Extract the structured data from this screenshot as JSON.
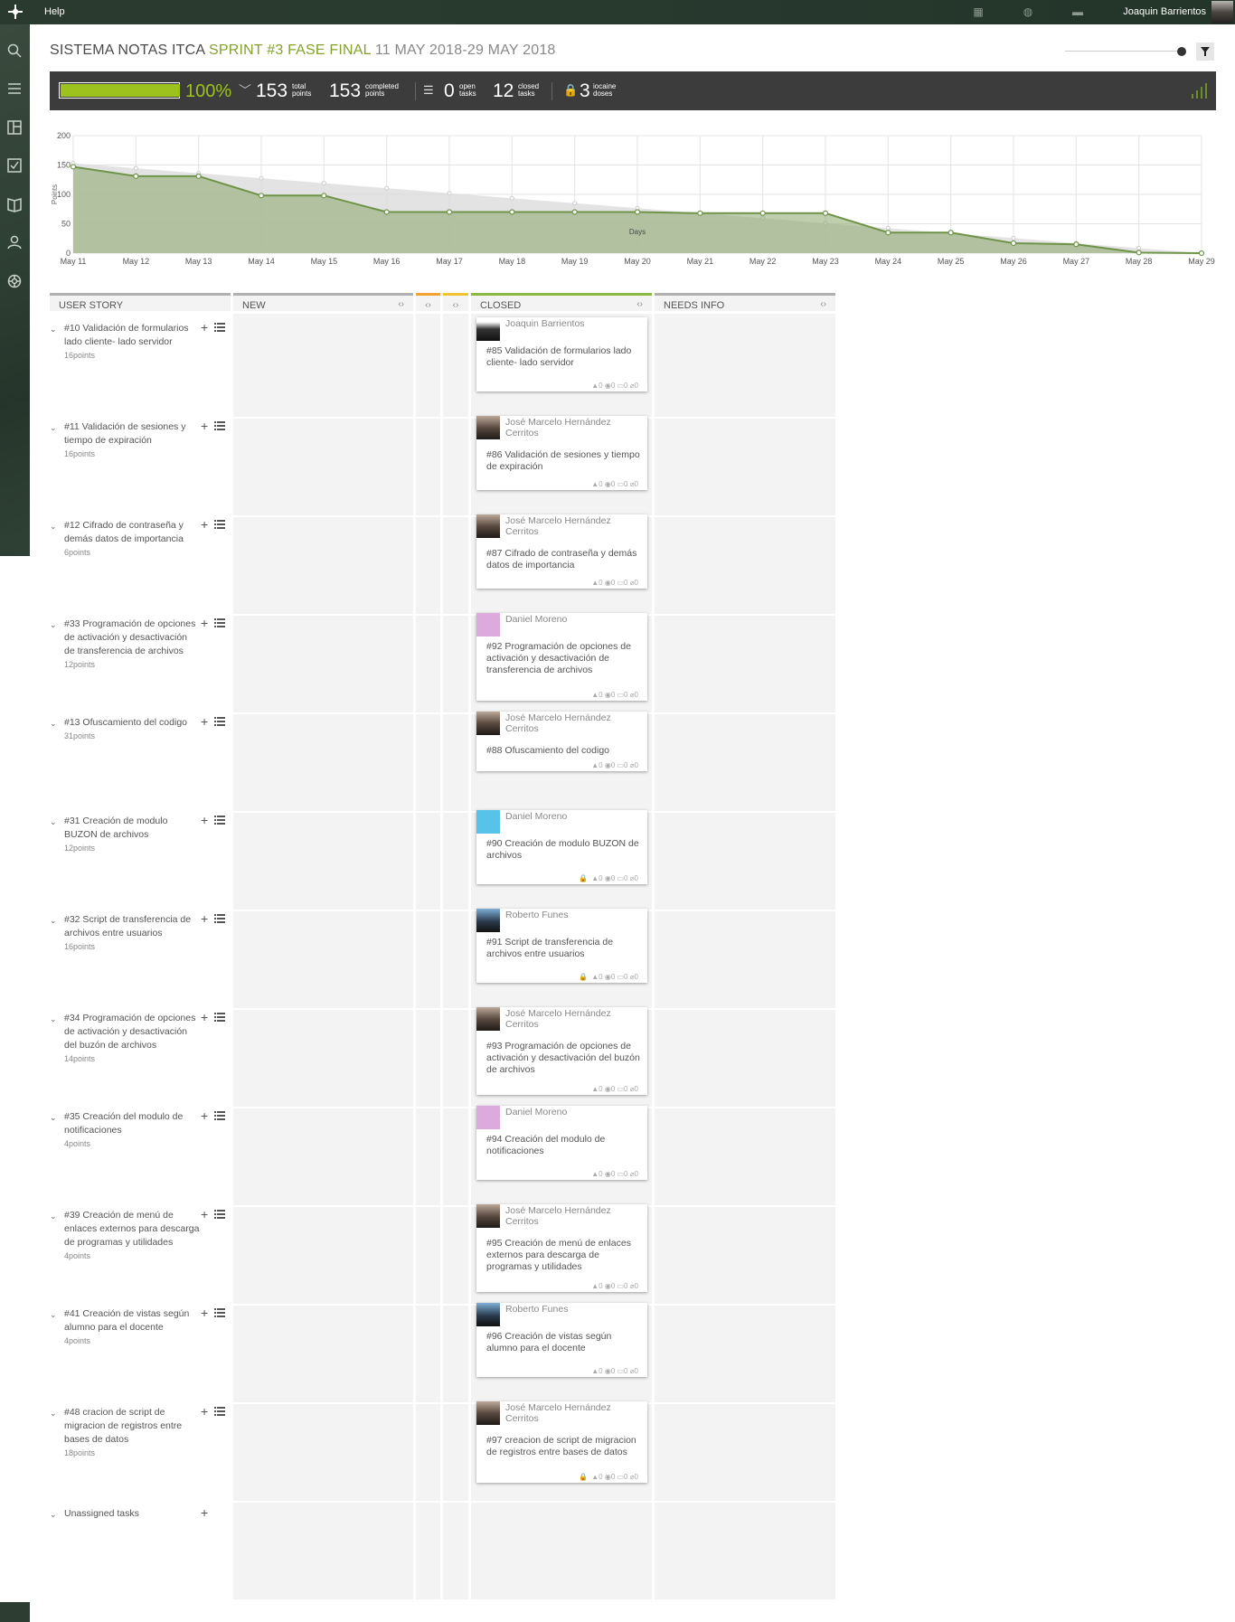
{
  "topbar": {
    "help": "Help",
    "user": "Joaquin Barrientos"
  },
  "sprint": {
    "project": "SISTEMA NOTAS ITCA",
    "name": "SPRINT #3 FASE FINAL",
    "dates": "11 MAY 2018-29 MAY 2018"
  },
  "stats": {
    "progress_percent": 100,
    "percent_label": "100%",
    "total_points": "153",
    "total_label_1": "total",
    "total_label_2": "points",
    "completed_points": "153",
    "completed_label_1": "completed",
    "completed_label_2": "points",
    "open_tasks": "0",
    "open_label_1": "open",
    "open_label_2": "tasks",
    "closed_tasks": "12",
    "closed_label_1": "closed",
    "closed_label_2": "tasks",
    "iocaine": "3",
    "iocaine_label_1": "iocaine",
    "iocaine_label_2": "doses"
  },
  "chart_data": {
    "type": "area",
    "ylabel": "Points",
    "xlabel": "Days",
    "ylim": [
      0,
      200
    ],
    "yticks": [
      "0",
      "50",
      "100",
      "150",
      "200"
    ],
    "categories": [
      "May 11",
      "May 12",
      "May 13",
      "May 14",
      "May 15",
      "May 16",
      "May 17",
      "May 18",
      "May 19",
      "May 20",
      "May 21",
      "May 22",
      "May 23",
      "May 24",
      "May 25",
      "May 26",
      "May 27",
      "May 28",
      "May 29"
    ],
    "series": [
      {
        "values": [
          153,
          144.5,
          136,
          127.5,
          119,
          110.5,
          102,
          93.5,
          85,
          76.5,
          68,
          59.5,
          51,
          42.5,
          34,
          25.5,
          17,
          8.5,
          0
        ]
      },
      {
        "values": [
          147,
          131,
          131,
          98,
          98,
          70,
          70,
          70,
          70,
          70,
          68,
          68,
          68,
          35,
          35,
          17,
          15,
          1,
          0
        ]
      }
    ],
    "colors": {
      "ideal": "#dcdcdc",
      "actual": "#8aa86b"
    }
  },
  "board": {
    "columns": [
      {
        "label": "USER STORY"
      },
      {
        "label": "NEW"
      },
      {
        "label": ""
      },
      {
        "label": ""
      },
      {
        "label": "CLOSED"
      },
      {
        "label": "NEEDS INFO"
      }
    ],
    "rows": [
      {
        "story": "#10 Validación de formularios lado cliente- lado servidor",
        "points": "16points",
        "owner": "Joaquin Barrientos",
        "task": "#85 Validación de formularios lado cliente- lado servidor",
        "meta": "▲0 ◉0 ▭0 ⌀0",
        "lock": ""
      },
      {
        "story": "#11 Validación de sesiones y tiempo de expiración",
        "points": "16points",
        "owner": "José Marcelo Hernández Cerritos",
        "task": "#86 Validación de sesiones y tiempo de expiración",
        "meta": "▲0 ◉0 ▭0 ⌀0",
        "lock": ""
      },
      {
        "story": "#12 Cifrado de contraseña y demás datos de importancia",
        "points": "6points",
        "owner": "José Marcelo Hernández Cerritos",
        "task": "#87 Cifrado de contraseña y demás datos de importancia",
        "meta": "▲0 ◉0 ▭0 ⌀0",
        "lock": ""
      },
      {
        "story": "#33 Programación de opciones de activación y desactivación de transferencia de archivos",
        "points": "12points",
        "owner": "Daniel Moreno",
        "task": "#92 Programación de opciones de activación y desactivación de transferencia de archivos",
        "meta": "▲0 ◉0 ▭0 ⌀0",
        "lock": ""
      },
      {
        "story": "#13 Ofuscamiento del codigo",
        "points": "31points",
        "owner": "José Marcelo Hernández Cerritos",
        "task": "#88 Ofuscamiento del codigo",
        "meta": "▲0 ◉0 ▭0 ⌀0",
        "lock": ""
      },
      {
        "story": "#31 Creación de modulo BUZON de archivos",
        "points": "12points",
        "owner": "Daniel Moreno",
        "task": "#90 Creación de modulo BUZON de archivos",
        "meta": "▲0 ◉0 ▭0 ⌀0",
        "lock": "🔒"
      },
      {
        "story": "#32 Script de transferencia de archivos entre usuarios",
        "points": "16points",
        "owner": "Roberto Funes",
        "task": "#91 Script de transferencia de archivos entre usuarios",
        "meta": "▲0 ◉0 ▭0 ⌀0",
        "lock": "🔒"
      },
      {
        "story": "#34 Programación de opciones de activación y desactivación del buzón de archivos",
        "points": "14points",
        "owner": "José Marcelo Hernández Cerritos",
        "task": "#93 Programación de opciones de activación y desactivación del buzón de archivos",
        "meta": "▲0 ◉0 ▭0 ⌀0",
        "lock": ""
      },
      {
        "story": "#35 Creación del modulo de notificaciones",
        "points": "4points",
        "owner": "Daniel Moreno",
        "task": "#94 Creación del modulo de notificaciones",
        "meta": "▲0 ◉0 ▭0 ⌀0",
        "lock": ""
      },
      {
        "story": "#39 Creación de menú de enlaces externos para descarga de programas y utilidades",
        "points": "4points",
        "owner": "José Marcelo Hernández Cerritos",
        "task": "#95 Creación de menú de enlaces externos para descarga de programas y utilidades",
        "meta": "▲0 ◉0 ▭0 ⌀0",
        "lock": ""
      },
      {
        "story": "#41 Creación de vistas según alumno para el docente",
        "points": "4points",
        "owner": "Roberto Funes",
        "task": "#96 Creación de vistas según alumno para el docente",
        "meta": "▲0 ◉0 ▭0 ⌀0",
        "lock": ""
      },
      {
        "story": "#48 cracion de script de migracion de registros entre bases de datos",
        "points": "18points",
        "owner": "José Marcelo Hernández Cerritos",
        "task": "#97 creacion de script de migracion de registros entre bases de datos",
        "meta": "▲0 ◉0 ▭0 ⌀0",
        "lock": "🔒"
      }
    ],
    "unassigned": "Unassigned tasks"
  }
}
